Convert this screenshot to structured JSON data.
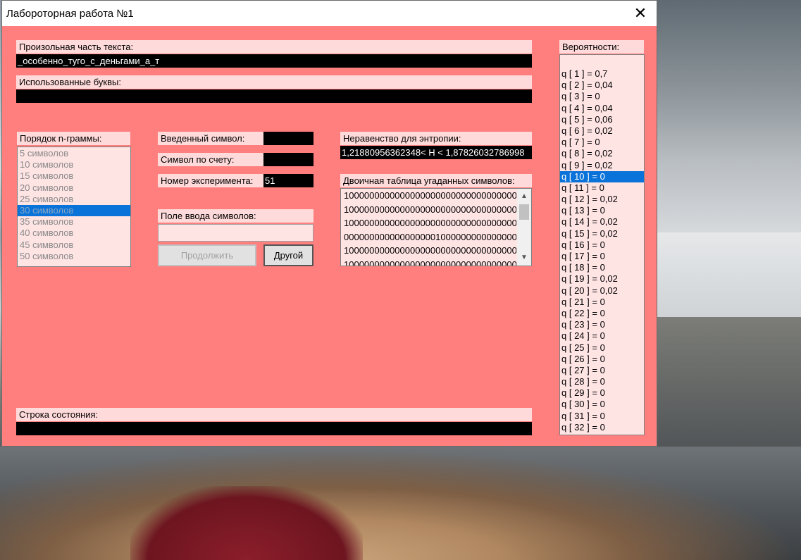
{
  "window": {
    "title": "Лабороторная работа №1",
    "close_glyph": "✕"
  },
  "random_text": {
    "label": "Произольная часть текста:",
    "value": "_особенно_туго_с_деньгами_а_т"
  },
  "used_letters": {
    "label": "Использованные буквы:",
    "value": ""
  },
  "ngram": {
    "label": "Порядок n-граммы:",
    "items": [
      "5 символов",
      "10 символов",
      "15 символов",
      "20 символов",
      "25 символов",
      "30 символов",
      "35 символов",
      "40 символов",
      "45 символов",
      "50 символов"
    ],
    "selected_index": 5
  },
  "entered_symbol": {
    "label": "Введенный символ:",
    "value": ""
  },
  "symbol_count": {
    "label": "Символ по счету:",
    "value": ""
  },
  "experiment_number": {
    "label": "Номер эксперимента:",
    "value": "51"
  },
  "symbol_input": {
    "label": "Поле ввода символов:",
    "value": ""
  },
  "buttons": {
    "continue": "Продолжить",
    "other": "Другой"
  },
  "entropy": {
    "label": "Неравенство для энтропии:",
    "value": "1,21880956362348< H < 1,87826032786998"
  },
  "binary_table": {
    "label": "Двоичная таблица угаданных символов:",
    "rows": [
      "100000000000000000000000000000000000",
      "100000000000000000000000000000000000",
      "100000000000000000000000000000000000",
      "000000000000000000100000000000000000",
      "100000000000000000000000000000000000",
      "100000000000000000000000000000000000"
    ]
  },
  "status": {
    "label": "Строка состояния:",
    "value": ""
  },
  "probabilities": {
    "label": "Вероятности:",
    "items": [
      "q [ 1 ] = 0,7",
      "q [ 2 ] = 0,04",
      "q [ 3 ] = 0",
      "q [ 4 ] = 0,04",
      "q [ 5 ] = 0,06",
      "q [ 6 ] = 0,02",
      "q [ 7 ] = 0",
      "q [ 8 ] = 0,02",
      "q [ 9 ] = 0,02",
      "q [ 10 ] = 0",
      "q [ 11 ] = 0",
      "q [ 12 ] = 0,02",
      "q [ 13 ] = 0",
      "q [ 14 ] = 0,02",
      "q [ 15 ] = 0,02",
      "q [ 16 ] = 0",
      "q [ 17 ] = 0",
      "q [ 18 ] = 0",
      "q [ 19 ] = 0,02",
      "q [ 20 ] = 0,02",
      "q [ 21 ] = 0",
      "q [ 22 ] = 0",
      "q [ 23 ] = 0",
      "q [ 24 ] = 0",
      "q [ 25 ] = 0",
      "q [ 26 ] = 0",
      "q [ 27 ] = 0",
      "q [ 28 ] = 0",
      "q [ 29 ] = 0",
      "q [ 30 ] = 0",
      "q [ 31 ] = 0",
      "q [ 32 ] = 0"
    ],
    "selected_index": 9
  },
  "colors": {
    "form_background": "#ff7f7f",
    "label_background": "#ffdada",
    "list_background": "#ffe4e4",
    "selection": "#0a73d9"
  }
}
